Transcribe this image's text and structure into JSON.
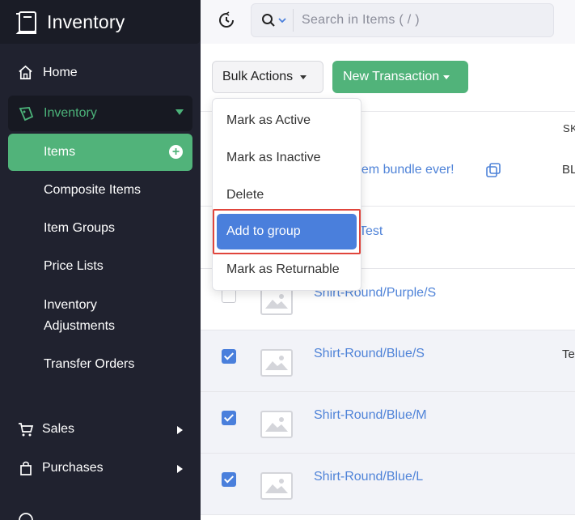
{
  "app": {
    "title": "Inventory"
  },
  "sidebar": {
    "home": "Home",
    "inventory": "Inventory",
    "items": "Items",
    "sub_items": [
      "Composite Items",
      "Item Groups",
      "Price Lists",
      "Inventory Adjustments",
      "Transfer Orders"
    ],
    "sales": "Sales",
    "purchases": "Purchases"
  },
  "search": {
    "placeholder": "Search in Items ( / )"
  },
  "toolbar": {
    "bulk_actions": "Bulk Actions",
    "new_transaction": "New Transaction"
  },
  "bulk_menu": {
    "items": [
      "Mark as Active",
      "Mark as Inactive",
      "Delete",
      "Add to group",
      "Mark as Returnable"
    ],
    "highlighted": "Add to group"
  },
  "table": {
    "column_sku": "SK",
    "rows": [
      {
        "name": "st item bundle ever!",
        "sku": "BL",
        "checked": null
      },
      {
        "name": "Test",
        "sku": "",
        "checked": null
      },
      {
        "name": "Shirt-Round/Purple/S",
        "sku": "",
        "checked": false
      },
      {
        "name": "Shirt-Round/Blue/S",
        "sku": "Te",
        "checked": true
      },
      {
        "name": "Shirt-Round/Blue/M",
        "sku": "",
        "checked": true
      },
      {
        "name": "Shirt-Round/Blue/L",
        "sku": "",
        "checked": true
      }
    ]
  },
  "colors": {
    "sidebar_bg": "#20222f",
    "accent_green": "#51b37a",
    "accent_blue": "#4a7fdc",
    "highlight_border": "#e0453c"
  }
}
